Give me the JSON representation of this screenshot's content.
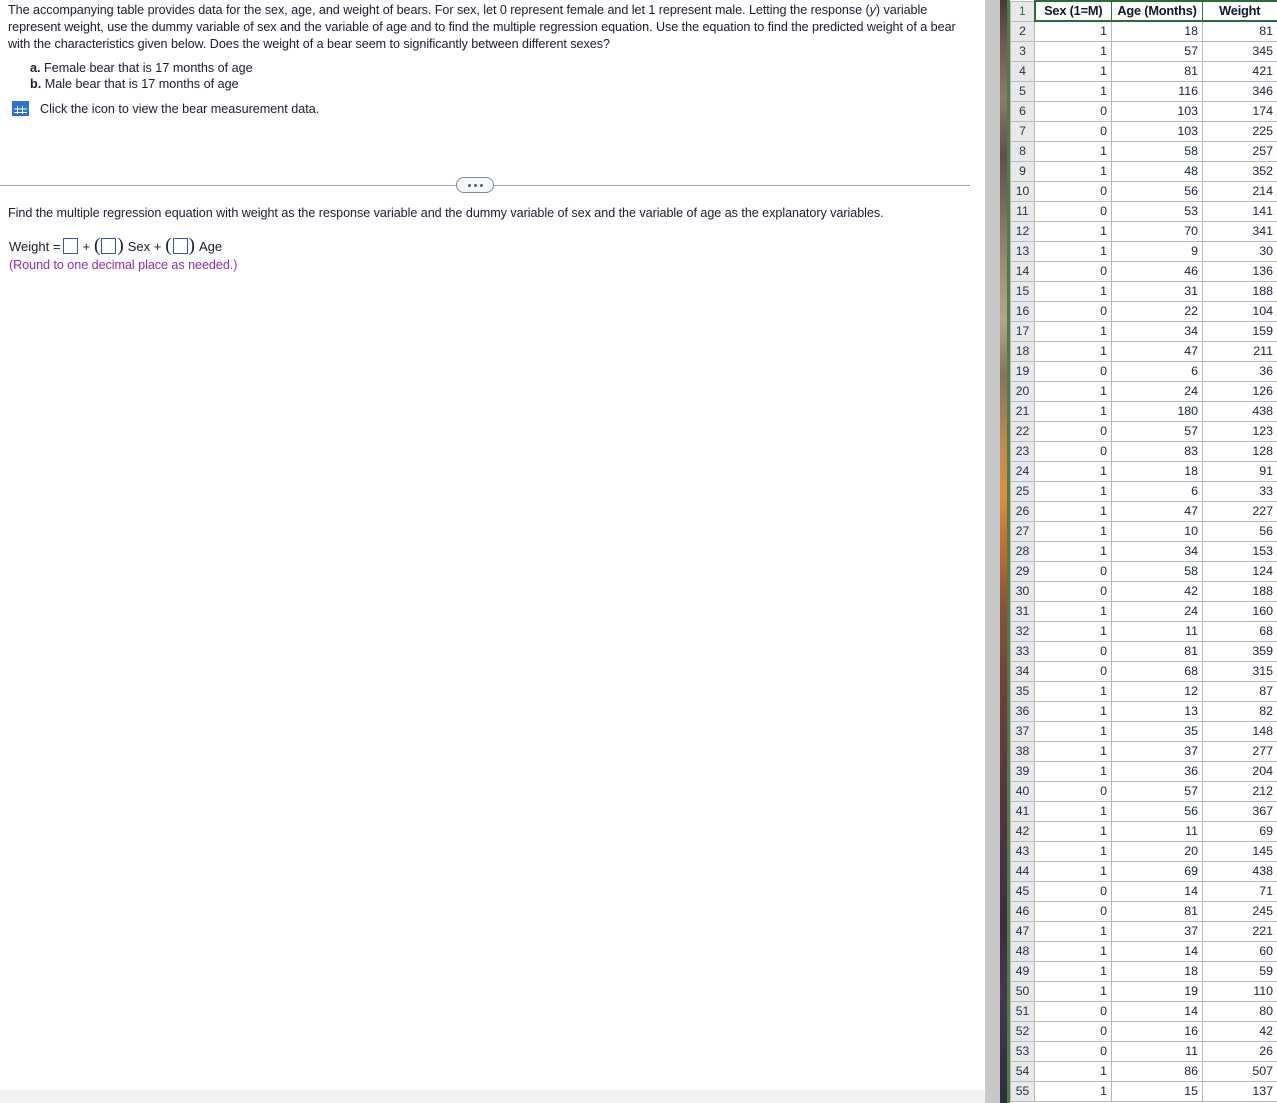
{
  "problem": {
    "paragraph": "The accompanying table provides data for the sex, age, and weight of bears. For sex, let 0 represent female and let 1 represent male. Letting the response (y) variable represent weight, use the dummy variable of sex and the variable of age and to find the multiple regression equation. Use the equation to find the predicted weight of a bear with the characteristics given below. Does the weight of a bear seem to significantly between different sexes?",
    "parts": [
      {
        "label": "a.",
        "text": "Female bear that is 17 months of age"
      },
      {
        "label": "b.",
        "text": "Male bear that is 17 months of age"
      }
    ],
    "icon_caption": "Click the icon to view the bear measurement data.",
    "icon_name": "table-grid-icon"
  },
  "divider": {
    "ellipsis": "..."
  },
  "answer_section": {
    "instruction": "Find the multiple regression equation with weight as the response variable and the dummy variable of sex and the variable of age as the explanatory variables.",
    "equation": {
      "lead": "Weight =",
      "plus1": "+",
      "open_paren": "(",
      "close_paren": ")",
      "term1": "Sex +",
      "term2": "Age"
    },
    "inputs": {
      "intercept": "",
      "sex_coefficient": "",
      "age_coefficient": ""
    },
    "round_note": "(Round to one decimal place as needed.)",
    "note_color": "#8b2fb0",
    "input_border_color": "#3a4ec4"
  },
  "spreadsheet": {
    "header_row_number": "1",
    "columns": [
      "Sex (1=M)",
      "Age (Months)",
      "Weight"
    ],
    "rows": [
      {
        "n": "2",
        "sex": "1",
        "age": "18",
        "weight": "81"
      },
      {
        "n": "3",
        "sex": "1",
        "age": "57",
        "weight": "345"
      },
      {
        "n": "4",
        "sex": "1",
        "age": "81",
        "weight": "421"
      },
      {
        "n": "5",
        "sex": "1",
        "age": "116",
        "weight": "346"
      },
      {
        "n": "6",
        "sex": "0",
        "age": "103",
        "weight": "174"
      },
      {
        "n": "7",
        "sex": "0",
        "age": "103",
        "weight": "225"
      },
      {
        "n": "8",
        "sex": "1",
        "age": "58",
        "weight": "257"
      },
      {
        "n": "9",
        "sex": "1",
        "age": "48",
        "weight": "352"
      },
      {
        "n": "10",
        "sex": "0",
        "age": "56",
        "weight": "214"
      },
      {
        "n": "11",
        "sex": "0",
        "age": "53",
        "weight": "141"
      },
      {
        "n": "12",
        "sex": "1",
        "age": "70",
        "weight": "341"
      },
      {
        "n": "13",
        "sex": "1",
        "age": "9",
        "weight": "30"
      },
      {
        "n": "14",
        "sex": "0",
        "age": "46",
        "weight": "136"
      },
      {
        "n": "15",
        "sex": "1",
        "age": "31",
        "weight": "188"
      },
      {
        "n": "16",
        "sex": "0",
        "age": "22",
        "weight": "104"
      },
      {
        "n": "17",
        "sex": "1",
        "age": "34",
        "weight": "159"
      },
      {
        "n": "18",
        "sex": "1",
        "age": "47",
        "weight": "211"
      },
      {
        "n": "19",
        "sex": "0",
        "age": "6",
        "weight": "36"
      },
      {
        "n": "20",
        "sex": "1",
        "age": "24",
        "weight": "126"
      },
      {
        "n": "21",
        "sex": "1",
        "age": "180",
        "weight": "438"
      },
      {
        "n": "22",
        "sex": "0",
        "age": "57",
        "weight": "123"
      },
      {
        "n": "23",
        "sex": "0",
        "age": "83",
        "weight": "128"
      },
      {
        "n": "24",
        "sex": "1",
        "age": "18",
        "weight": "91"
      },
      {
        "n": "25",
        "sex": "1",
        "age": "6",
        "weight": "33"
      },
      {
        "n": "26",
        "sex": "1",
        "age": "47",
        "weight": "227"
      },
      {
        "n": "27",
        "sex": "1",
        "age": "10",
        "weight": "56"
      },
      {
        "n": "28",
        "sex": "1",
        "age": "34",
        "weight": "153"
      },
      {
        "n": "29",
        "sex": "0",
        "age": "58",
        "weight": "124"
      },
      {
        "n": "30",
        "sex": "0",
        "age": "42",
        "weight": "188"
      },
      {
        "n": "31",
        "sex": "1",
        "age": "24",
        "weight": "160"
      },
      {
        "n": "32",
        "sex": "1",
        "age": "11",
        "weight": "68"
      },
      {
        "n": "33",
        "sex": "0",
        "age": "81",
        "weight": "359"
      },
      {
        "n": "34",
        "sex": "0",
        "age": "68",
        "weight": "315"
      },
      {
        "n": "35",
        "sex": "1",
        "age": "12",
        "weight": "87"
      },
      {
        "n": "36",
        "sex": "1",
        "age": "13",
        "weight": "82"
      },
      {
        "n": "37",
        "sex": "1",
        "age": "35",
        "weight": "148"
      },
      {
        "n": "38",
        "sex": "1",
        "age": "37",
        "weight": "277"
      },
      {
        "n": "39",
        "sex": "1",
        "age": "36",
        "weight": "204"
      },
      {
        "n": "40",
        "sex": "0",
        "age": "57",
        "weight": "212"
      },
      {
        "n": "41",
        "sex": "1",
        "age": "56",
        "weight": "367"
      },
      {
        "n": "42",
        "sex": "1",
        "age": "11",
        "weight": "69"
      },
      {
        "n": "43",
        "sex": "1",
        "age": "20",
        "weight": "145"
      },
      {
        "n": "44",
        "sex": "1",
        "age": "69",
        "weight": "438"
      },
      {
        "n": "45",
        "sex": "0",
        "age": "14",
        "weight": "71"
      },
      {
        "n": "46",
        "sex": "0",
        "age": "81",
        "weight": "245"
      },
      {
        "n": "47",
        "sex": "1",
        "age": "37",
        "weight": "221"
      },
      {
        "n": "48",
        "sex": "1",
        "age": "14",
        "weight": "60"
      },
      {
        "n": "49",
        "sex": "1",
        "age": "18",
        "weight": "59"
      },
      {
        "n": "50",
        "sex": "1",
        "age": "19",
        "weight": "110"
      },
      {
        "n": "51",
        "sex": "0",
        "age": "14",
        "weight": "80"
      },
      {
        "n": "52",
        "sex": "0",
        "age": "16",
        "weight": "42"
      },
      {
        "n": "53",
        "sex": "0",
        "age": "11",
        "weight": "26"
      },
      {
        "n": "54",
        "sex": "1",
        "age": "86",
        "weight": "507"
      },
      {
        "n": "55",
        "sex": "1",
        "age": "15",
        "weight": "137"
      }
    ]
  }
}
